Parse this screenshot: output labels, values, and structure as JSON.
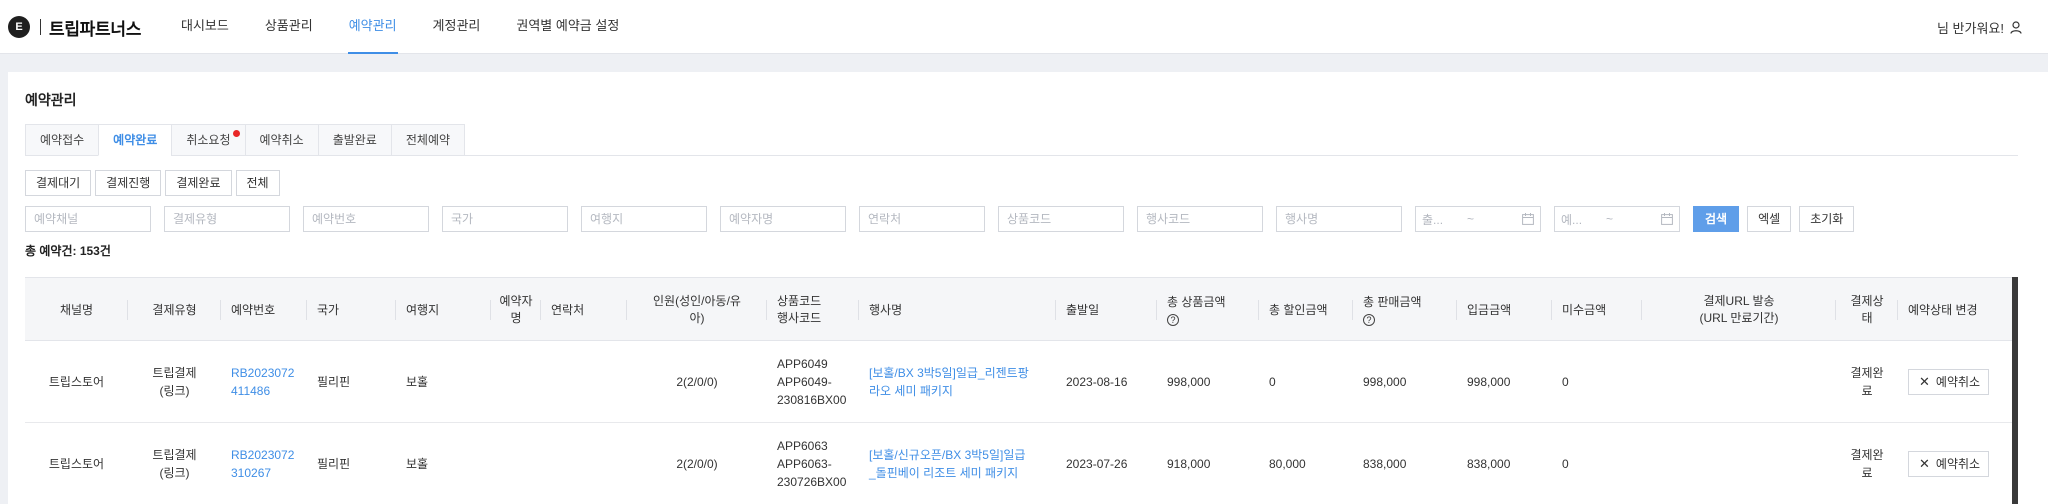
{
  "nav": {
    "logo_letter": "E",
    "brand": "트립파트너스",
    "menu": [
      {
        "label": "대시보드",
        "active": false
      },
      {
        "label": "상품관리",
        "active": false
      },
      {
        "label": "예약관리",
        "active": true
      },
      {
        "label": "계정관리",
        "active": false
      },
      {
        "label": "권역별 예약금 설정",
        "active": false
      }
    ],
    "welcome": "님 반가워요!"
  },
  "page": {
    "title": "예약관리",
    "tabs": [
      {
        "label": "예약접수",
        "active": false,
        "dot": false
      },
      {
        "label": "예약완료",
        "active": true,
        "dot": false
      },
      {
        "label": "취소요청",
        "active": false,
        "dot": true
      },
      {
        "label": "예약취소",
        "active": false,
        "dot": false
      },
      {
        "label": "출발완료",
        "active": false,
        "dot": false
      },
      {
        "label": "전체예약",
        "active": false,
        "dot": false
      }
    ],
    "payment_filters": [
      "결제대기",
      "결제진행",
      "결제완료",
      "전체"
    ],
    "search": {
      "placeholders": [
        "예약채널",
        "결제유형",
        "예약번호",
        "국가",
        "여행지",
        "예약자명",
        "연락처",
        "상품코드",
        "행사코드",
        "행사명"
      ],
      "date1": {
        "start": "출...",
        "tilde": "~"
      },
      "date2": {
        "start": "예...",
        "tilde": "~"
      },
      "search_label": "검색",
      "excel_label": "엑셀",
      "reset_label": "초기화"
    },
    "total": "총 예약건: 153건"
  },
  "table": {
    "headers": {
      "channel": "채널명",
      "paytype": "결제유형",
      "resno": "예약번호",
      "country": "국가",
      "dest": "여행지",
      "booker": "예약자\n명",
      "contact": "연락처",
      "people": "인원(성인/아동/유\n아)",
      "codes": "상품코드\n행사코드",
      "event": "행사명",
      "depart": "출발일",
      "total_price": "총 상품금액",
      "discount": "총 할인금액",
      "sale": "총 판매금액",
      "deposit": "입금금액",
      "unpaid": "미수금액",
      "payurl": "결제URL 발송\n(URL 만료기간)",
      "paystatus": "결제상\n태",
      "statuschange": "예약상태 변경"
    },
    "rows": [
      {
        "channel": "트립스토어",
        "paytype": "트립결제\n(링크)",
        "resno": "RB2023072\n411486",
        "country": "필리핀",
        "dest": "보홀",
        "booker": "",
        "contact": "",
        "people": "2(2/0/0)",
        "codes": "APP6049\nAPP6049-\n230816BX00",
        "event": "[보홀/BX 3박5일]일급_리젠트팡\n라오 세미 패키지",
        "depart": "2023-08-16",
        "total_price": "998,000",
        "discount": "0",
        "sale": "998,000",
        "deposit": "998,000",
        "unpaid": "0",
        "payurl": "",
        "paystatus": "결제완\n료",
        "action": "예약취소"
      },
      {
        "channel": "트립스토어",
        "paytype": "트립결제\n(링크)",
        "resno": "RB2023072\n310267",
        "country": "필리핀",
        "dest": "보홀",
        "booker": "",
        "contact": "",
        "people": "2(2/0/0)",
        "codes": "APP6063\nAPP6063-\n230726BX00",
        "event": "[보홀/신규오픈/BX 3박5일]일급\n_돌핀베이 리조트 세미 패키지",
        "depart": "2023-07-26",
        "total_price": "918,000",
        "discount": "80,000",
        "sale": "838,000",
        "deposit": "838,000",
        "unpaid": "0",
        "payurl": "",
        "paystatus": "결제완\n료",
        "action": "예약취소"
      }
    ]
  },
  "colors": {
    "accent": "#3f8ee6",
    "primary_button": "#5f9ee9",
    "alert_dot": "#e82727"
  },
  "icons": {
    "user": "user-icon",
    "calendar": "calendar-icon",
    "help": "question-circle-icon",
    "close": "close-icon"
  }
}
